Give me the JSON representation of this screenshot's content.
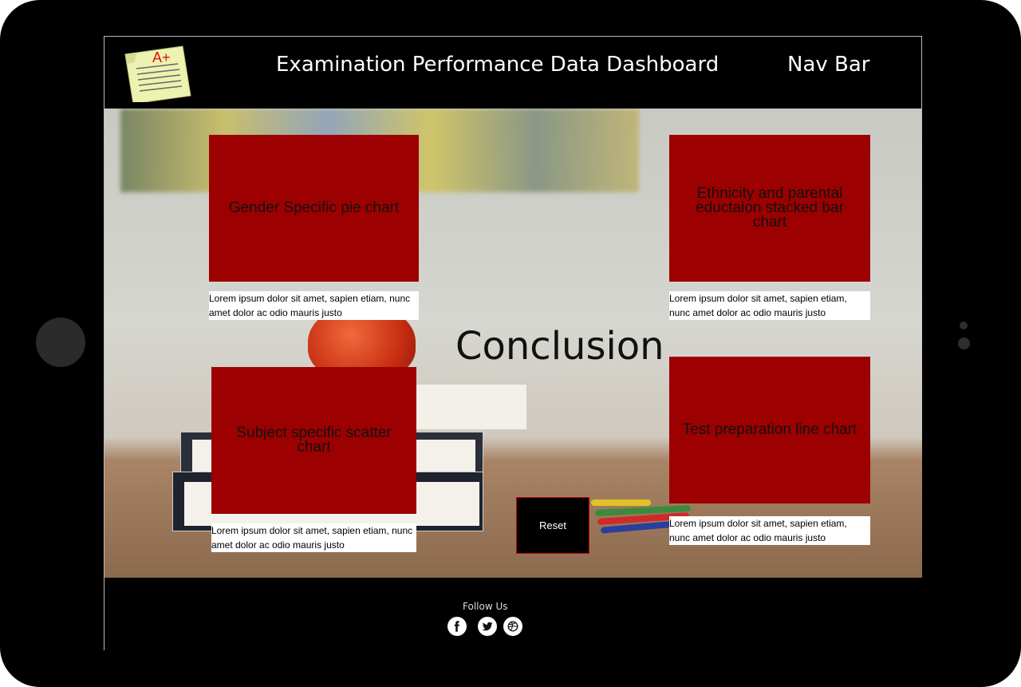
{
  "header": {
    "title": "Examination Performance Data Dashboard",
    "nav": "Nav Bar",
    "logo_text": "A+"
  },
  "cards": [
    {
      "title": "Gender Specific pie  chart",
      "caption": "Lorem ipsum dolor sit amet, sapien etiam, nunc amet dolor ac odio mauris justo"
    },
    {
      "title": "Ethnicity and parental eductaion stacked bar chart",
      "caption": "Lorem ipsum dolor sit amet, sapien etiam, nunc amet dolor ac odio mauris justo"
    },
    {
      "title": "Subject specific scatter chart",
      "caption": "Lorem ipsum dolor sit amet, sapien etiam, nunc amet dolor ac odio mauris justo"
    },
    {
      "title": "Test preparation line chart",
      "caption": "Lorem ipsum dolor sit amet, sapien etiam, nunc amet dolor ac odio mauris justo"
    }
  ],
  "main": {
    "conclusion": "Conclusion",
    "reset_label": "Reset"
  },
  "footer": {
    "follow_label": "Follow Us",
    "social_icons": [
      "facebook-icon",
      "twitter-icon",
      "dribbble-icon"
    ]
  },
  "colors": {
    "card_bg": "#9c0000",
    "frame": "#000000",
    "reset_border": "#c40000"
  }
}
